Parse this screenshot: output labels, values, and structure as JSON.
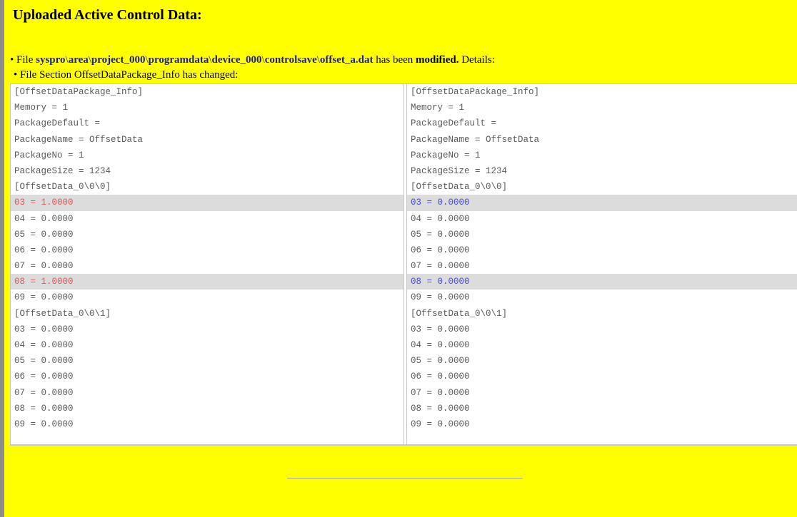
{
  "heading": "Uploaded Active Control Data:",
  "file_line": {
    "bullet": "•",
    "prefix": "File",
    "path": [
      "syspro",
      "area",
      "project_000",
      "programdata",
      "device_000",
      "controlsave",
      "offset_a.dat"
    ],
    "separator": "\\",
    "middle": "has been",
    "status": "modified.",
    "suffix": "Details:"
  },
  "section_line": "• File Section OffsetDataPackage_Info has changed:",
  "diff": {
    "left": [
      {
        "text": "[OffsetDataPackage_Info]",
        "changed": false
      },
      {
        "text": "Memory = 1",
        "changed": false
      },
      {
        "text": "PackageDefault =",
        "changed": false
      },
      {
        "text": "PackageName = OffsetData",
        "changed": false
      },
      {
        "text": "PackageNo = 1",
        "changed": false
      },
      {
        "text": "PackageSize = 1234",
        "changed": false
      },
      {
        "text": "[OffsetData_0\\0\\0]",
        "changed": false
      },
      {
        "text": "03 = 1.0000",
        "changed": true
      },
      {
        "text": "04 = 0.0000",
        "changed": false
      },
      {
        "text": "05 = 0.0000",
        "changed": false
      },
      {
        "text": "06 = 0.0000",
        "changed": false
      },
      {
        "text": "07 = 0.0000",
        "changed": false
      },
      {
        "text": "08 = 1.0000",
        "changed": true
      },
      {
        "text": "09 = 0.0000",
        "changed": false
      },
      {
        "text": "[OffsetData_0\\0\\1]",
        "changed": false
      },
      {
        "text": "03 = 0.0000",
        "changed": false
      },
      {
        "text": "04 = 0.0000",
        "changed": false
      },
      {
        "text": "05 = 0.0000",
        "changed": false
      },
      {
        "text": "06 = 0.0000",
        "changed": false
      },
      {
        "text": "07 = 0.0000",
        "changed": false
      },
      {
        "text": "08 = 0.0000",
        "changed": false
      },
      {
        "text": "09 = 0.0000",
        "changed": false
      }
    ],
    "right": [
      {
        "text": "[OffsetDataPackage_Info]",
        "changed": false
      },
      {
        "text": "Memory = 1",
        "changed": false
      },
      {
        "text": "PackageDefault =",
        "changed": false
      },
      {
        "text": "PackageName = OffsetData",
        "changed": false
      },
      {
        "text": "PackageNo = 1",
        "changed": false
      },
      {
        "text": "PackageSize = 1234",
        "changed": false
      },
      {
        "text": "[OffsetData_0\\0\\0]",
        "changed": false
      },
      {
        "text": "03 = 0.0000",
        "changed": true
      },
      {
        "text": "04 = 0.0000",
        "changed": false
      },
      {
        "text": "05 = 0.0000",
        "changed": false
      },
      {
        "text": "06 = 0.0000",
        "changed": false
      },
      {
        "text": "07 = 0.0000",
        "changed": false
      },
      {
        "text": "08 = 0.0000",
        "changed": true
      },
      {
        "text": "09 = 0.0000",
        "changed": false
      },
      {
        "text": "[OffsetData_0\\0\\1]",
        "changed": false
      },
      {
        "text": "03 = 0.0000",
        "changed": false
      },
      {
        "text": "04 = 0.0000",
        "changed": false
      },
      {
        "text": "05 = 0.0000",
        "changed": false
      },
      {
        "text": "06 = 0.0000",
        "changed": false
      },
      {
        "text": "07 = 0.0000",
        "changed": false
      },
      {
        "text": "08 = 0.0000",
        "changed": false
      },
      {
        "text": "09 = 0.0000",
        "changed": false
      }
    ]
  },
  "colors": {
    "background": "#ffff00",
    "path_text": "#1a1aa6",
    "removed_text": "#e0545a",
    "added_text": "#4a4ad8",
    "changed_row_bg": "#dcdcdc"
  }
}
